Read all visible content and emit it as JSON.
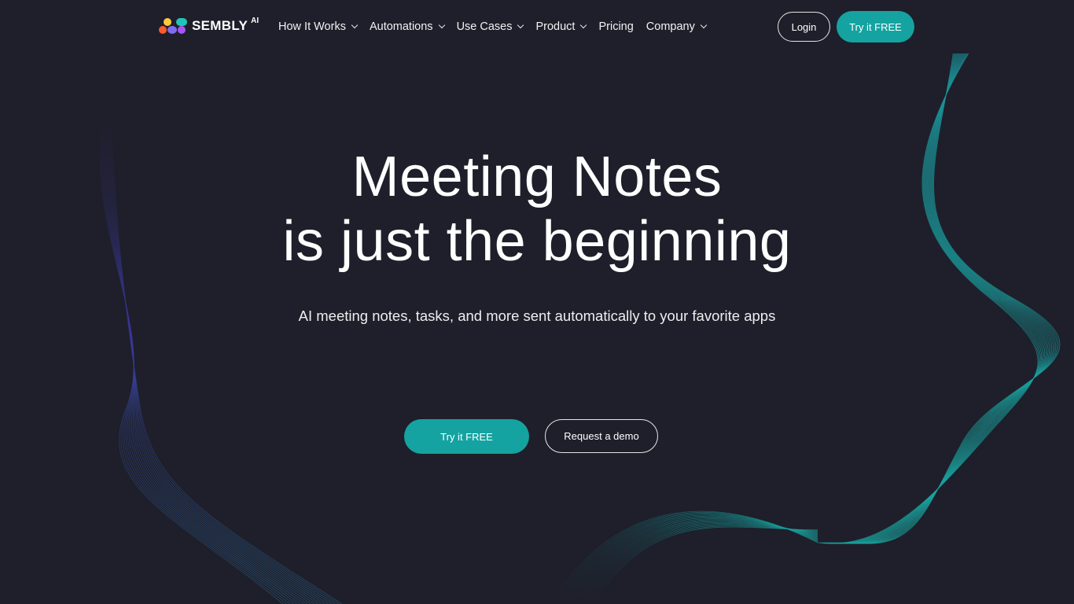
{
  "brand": {
    "name": "SEMBLY",
    "suffix": "AI",
    "dot_colors": [
      "#ffc93c",
      "#1fc4b8",
      "#ff5a2c",
      "#7b6cf0",
      "#a855f7"
    ]
  },
  "nav": {
    "items": [
      {
        "label": "How It Works",
        "has_dropdown": true
      },
      {
        "label": "Automations",
        "has_dropdown": true
      },
      {
        "label": "Use Cases",
        "has_dropdown": true
      },
      {
        "label": "Product",
        "has_dropdown": true
      },
      {
        "label": "Pricing",
        "has_dropdown": false
      },
      {
        "label": "Company",
        "has_dropdown": true
      }
    ],
    "login_label": "Login",
    "try_label": "Try it FREE"
  },
  "hero": {
    "title_line1": "Meeting Notes",
    "title_line2": "is just the beginning",
    "subtitle": "AI meeting notes, tasks, and more sent automatically to your favorite apps",
    "primary_cta": "Try it FREE",
    "secondary_cta": "Request a demo"
  },
  "colors": {
    "background": "#1e1f2a",
    "accent": "#14a3a1",
    "wave_teal": "#17a6a0",
    "wave_purple": "#4a3fb8"
  }
}
